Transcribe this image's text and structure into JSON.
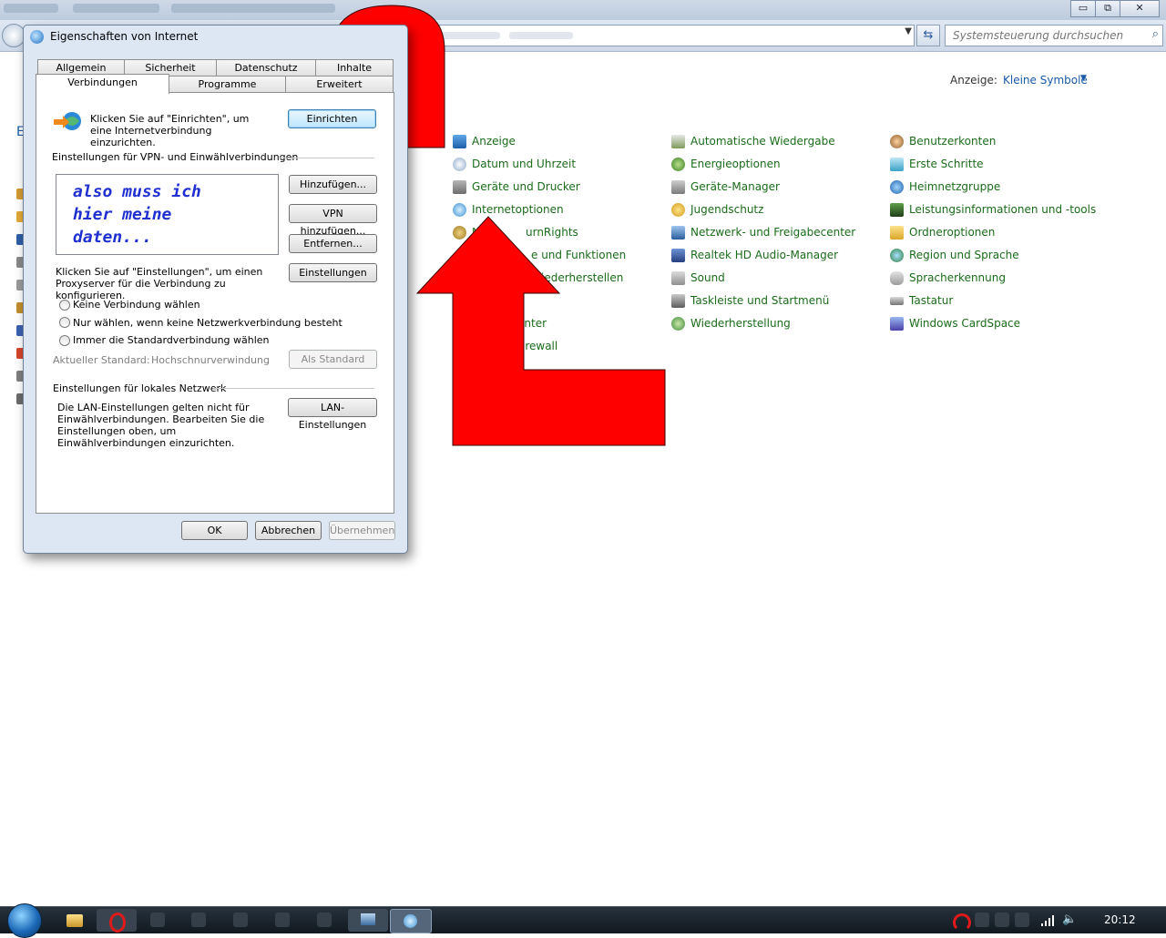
{
  "control_panel": {
    "search_placeholder": "Systemsteuerung durchsuchen",
    "view_label": "Anzeige:",
    "view_value": "Kleine Symbole",
    "left_letter": "E",
    "items": [
      {
        "label": "Anzeige",
        "icon": "monitor-icon"
      },
      {
        "label": "Datum und Uhrzeit",
        "icon": "clock-icon"
      },
      {
        "label": "Geräte und Drucker",
        "icon": "printer-icon"
      },
      {
        "label": "Internetoptionen",
        "icon": "internet-icon"
      },
      {
        "label": "N",
        "icon": "burn-icon"
      },
      {
        "label": "urnRights",
        "icon": ""
      },
      {
        "label": "e und Funktionen",
        "icon": ""
      },
      {
        "label": "iederherstellen",
        "icon": ""
      },
      {
        "label": "enter",
        "icon": ""
      },
      {
        "label": "irewall",
        "icon": ""
      },
      {
        "label": "Automatische Wiedergabe",
        "icon": "autoplay-icon"
      },
      {
        "label": "Energieoptionen",
        "icon": "power-icon"
      },
      {
        "label": "Geräte-Manager",
        "icon": "device-manager-icon"
      },
      {
        "label": "Jugendschutz",
        "icon": "parental-icon"
      },
      {
        "label": "Netzwerk- und Freigabecenter",
        "icon": "network-icon"
      },
      {
        "label": "Realtek HD Audio-Manager",
        "icon": "audio-manager-icon"
      },
      {
        "label": "Sound",
        "icon": "speaker-icon"
      },
      {
        "label": "Taskleiste und Startmenü",
        "icon": "taskbar-icon"
      },
      {
        "label": "Wiederherstellung",
        "icon": "recovery-icon"
      },
      {
        "label": "Benutzerkonten",
        "icon": "users-icon"
      },
      {
        "label": "Erste Schritte",
        "icon": "getting-started-icon"
      },
      {
        "label": "Heimnetzgruppe",
        "icon": "homegroup-icon"
      },
      {
        "label": "Leistungsinformationen und -tools",
        "icon": "performance-icon"
      },
      {
        "label": "Ordneroptionen",
        "icon": "folder-icon"
      },
      {
        "label": "Region und Sprache",
        "icon": "globe-icon"
      },
      {
        "label": "Spracherkennung",
        "icon": "microphone-icon"
      },
      {
        "label": "Tastatur",
        "icon": "keyboard-icon"
      },
      {
        "label": "Windows CardSpace",
        "icon": "cardspace-icon"
      }
    ]
  },
  "dialog": {
    "title": "Eigenschaften von Internet",
    "tabs_back": [
      "Allgemein",
      "Sicherheit",
      "Datenschutz",
      "Inhalte"
    ],
    "tabs_front": [
      "Verbindungen",
      "Programme",
      "Erweitert"
    ],
    "setup_text": "Klicken Sie auf \"Einrichten\", um eine Internetverbindung einzurichten.",
    "setup_button": "Einrichten",
    "vpn_section": "Einstellungen für VPN- und Einwählverbindungen",
    "list_text": "also muss ich\nhier meine\ndaten...",
    "add_button": "Hinzufügen...",
    "add_vpn_button": "VPN hinzufügen...",
    "remove_button": "Entfernen...",
    "settings_button": "Einstellungen",
    "proxy_text": "Klicken Sie auf \"Einstellungen\", um einen Proxyserver für die Verbindung zu konfigurieren.",
    "radio_options": [
      "Keine Verbindung wählen",
      "Nur wählen, wenn keine Netzwerkverbindung besteht",
      "Immer die Standardverbindung wählen"
    ],
    "current_default_label": "Aktueller Standard:",
    "current_default_value": "Hochschnurverwindung",
    "set_default_button": "Als Standard",
    "lan_section": "Einstellungen für lokales Netzwerk",
    "lan_text": "Die LAN-Einstellungen gelten nicht für Einwählverbindungen. Bearbeiten Sie die Einstellungen oben, um Einwählverbindungen einzurichten.",
    "lan_button": "LAN-Einstellungen",
    "ok_button": "OK",
    "cancel_button": "Abbrechen",
    "apply_button": "Übernehmen"
  },
  "annotation": {
    "arrow_color": "#ff0000"
  },
  "taskbar": {
    "clock": "20:12"
  },
  "window_buttons": {
    "minimize": "▭",
    "restore": "⧉",
    "close": "✕"
  }
}
